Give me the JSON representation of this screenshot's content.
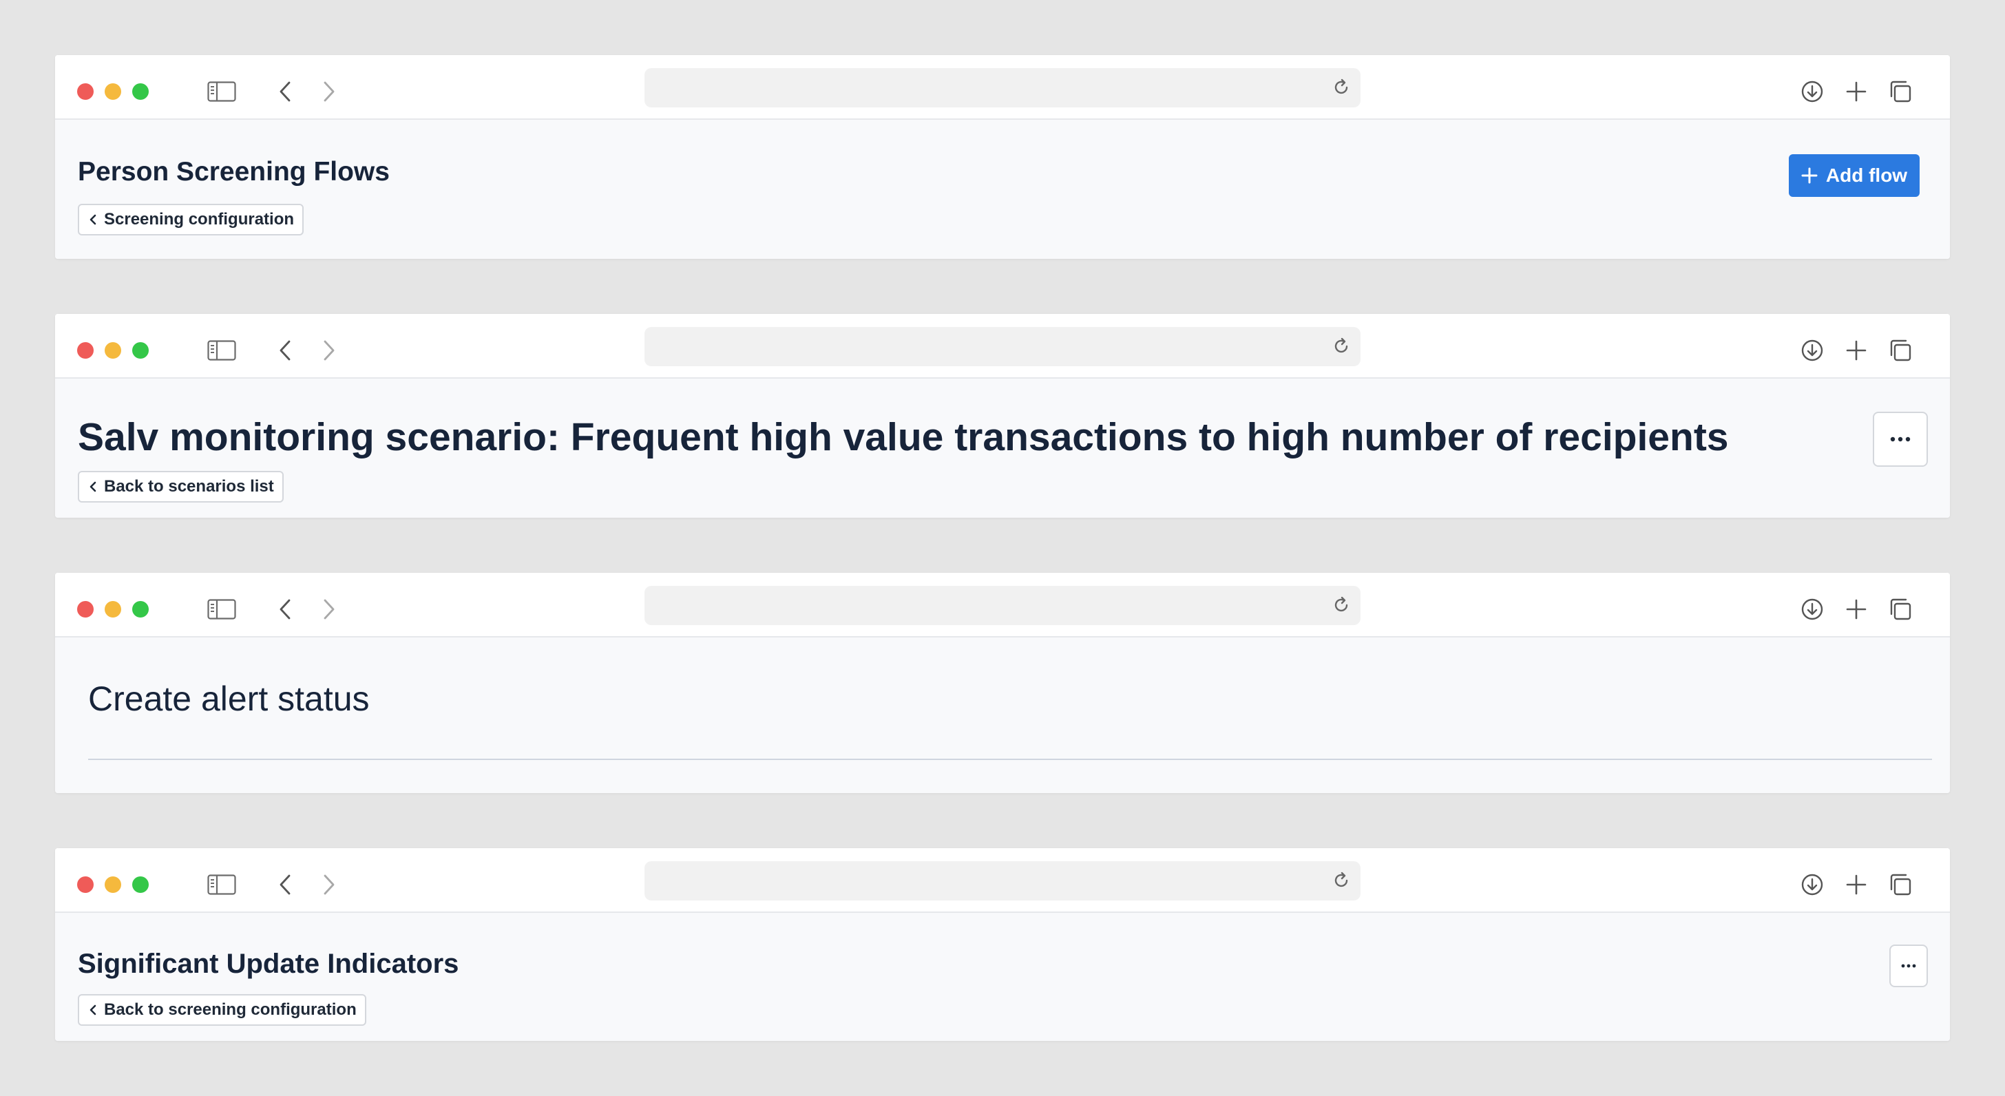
{
  "windows": [
    {
      "title": "Person Screening Flows",
      "back_link": "Screening configuration",
      "action_button": "Add flow"
    },
    {
      "title": "Salv monitoring scenario: Frequent high value transactions to high number of recipients",
      "back_link": "Back to scenarios list",
      "more_button": "more-icon"
    },
    {
      "title": "Create alert status"
    },
    {
      "title": "Significant Update Indicators",
      "back_link": "Back to screening configuration",
      "more_button": "more-icon"
    }
  ],
  "browser_controls": {
    "icons": [
      "sidebar-icon",
      "back-arrow-icon",
      "forward-arrow-icon",
      "reload-icon",
      "download-icon",
      "new-tab-icon",
      "tabs-overview-icon"
    ]
  },
  "colors": {
    "background": "#e5e5e5",
    "content_bg": "#f8f9fb",
    "primary": "#2b7ae0",
    "title_text": "#17243a",
    "traffic_red": "#ef5b58",
    "traffic_yellow": "#f5b93d",
    "traffic_green": "#34c748"
  }
}
